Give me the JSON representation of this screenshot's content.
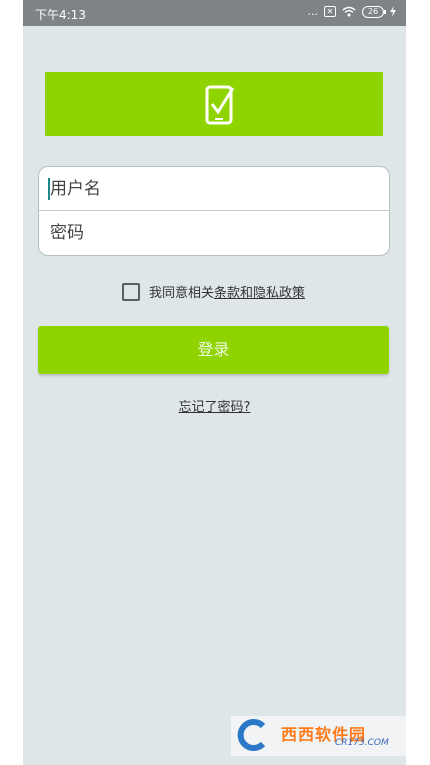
{
  "status_bar": {
    "time": "下午4:13",
    "dots": "...",
    "battery": "26"
  },
  "login_form": {
    "username_placeholder": "用户名",
    "password_placeholder": "密码"
  },
  "agreement": {
    "prefix": "我同意相关",
    "link": "条款和隐私政策",
    "checked": false
  },
  "login_button_label": "登录",
  "forgot_password_link": "忘记了密码?",
  "watermark": {
    "title": "西西软件园",
    "url": "CR173.COM"
  },
  "colors": {
    "accent": "#8fd400",
    "background": "#dfe6e8",
    "status_bar": "#7e8485"
  }
}
